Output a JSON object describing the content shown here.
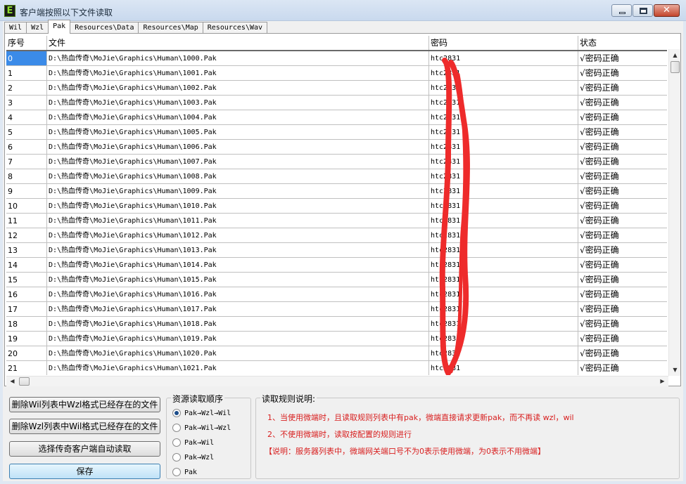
{
  "window": {
    "title": "客户端按照以下文件读取",
    "app_icon_letter": "E"
  },
  "tabs": [
    "Wil",
    "Wzl",
    "Pak",
    "Resources\\Data",
    "Resources\\Map",
    "Resources\\Wav"
  ],
  "active_tab": "Pak",
  "table": {
    "columns": [
      "序号",
      "文件",
      "密码",
      "状态"
    ],
    "rows": [
      {
        "index": "0",
        "file": "D:\\热血传奇\\MoJie\\Graphics\\Human\\1000.Pak",
        "password": "htc2831",
        "status": "√密码正确"
      },
      {
        "index": "1",
        "file": "D:\\热血传奇\\MoJie\\Graphics\\Human\\1001.Pak",
        "password": "htc2831",
        "status": "√密码正确"
      },
      {
        "index": "2",
        "file": "D:\\热血传奇\\MoJie\\Graphics\\Human\\1002.Pak",
        "password": "htc2831",
        "status": "√密码正确"
      },
      {
        "index": "3",
        "file": "D:\\热血传奇\\MoJie\\Graphics\\Human\\1003.Pak",
        "password": "htc2831",
        "status": "√密码正确"
      },
      {
        "index": "4",
        "file": "D:\\热血传奇\\MoJie\\Graphics\\Human\\1004.Pak",
        "password": "htc2831",
        "status": "√密码正确"
      },
      {
        "index": "5",
        "file": "D:\\热血传奇\\MoJie\\Graphics\\Human\\1005.Pak",
        "password": "htc2831",
        "status": "√密码正确"
      },
      {
        "index": "6",
        "file": "D:\\热血传奇\\MoJie\\Graphics\\Human\\1006.Pak",
        "password": "htc2831",
        "status": "√密码正确"
      },
      {
        "index": "7",
        "file": "D:\\热血传奇\\MoJie\\Graphics\\Human\\1007.Pak",
        "password": "htc2831",
        "status": "√密码正确"
      },
      {
        "index": "8",
        "file": "D:\\热血传奇\\MoJie\\Graphics\\Human\\1008.Pak",
        "password": "htc2831",
        "status": "√密码正确"
      },
      {
        "index": "9",
        "file": "D:\\热血传奇\\MoJie\\Graphics\\Human\\1009.Pak",
        "password": "htc2831",
        "status": "√密码正确"
      },
      {
        "index": "10",
        "file": "D:\\热血传奇\\MoJie\\Graphics\\Human\\1010.Pak",
        "password": "htc2831",
        "status": "√密码正确"
      },
      {
        "index": "11",
        "file": "D:\\热血传奇\\MoJie\\Graphics\\Human\\1011.Pak",
        "password": "htc2831",
        "status": "√密码正确"
      },
      {
        "index": "12",
        "file": "D:\\热血传奇\\MoJie\\Graphics\\Human\\1012.Pak",
        "password": "htc2831",
        "status": "√密码正确"
      },
      {
        "index": "13",
        "file": "D:\\热血传奇\\MoJie\\Graphics\\Human\\1013.Pak",
        "password": "htc2831",
        "status": "√密码正确"
      },
      {
        "index": "14",
        "file": "D:\\热血传奇\\MoJie\\Graphics\\Human\\1014.Pak",
        "password": "htc2831",
        "status": "√密码正确"
      },
      {
        "index": "15",
        "file": "D:\\热血传奇\\MoJie\\Graphics\\Human\\1015.Pak",
        "password": "htc2831",
        "status": "√密码正确"
      },
      {
        "index": "16",
        "file": "D:\\热血传奇\\MoJie\\Graphics\\Human\\1016.Pak",
        "password": "htc2831",
        "status": "√密码正确"
      },
      {
        "index": "17",
        "file": "D:\\热血传奇\\MoJie\\Graphics\\Human\\1017.Pak",
        "password": "htc2831",
        "status": "√密码正确"
      },
      {
        "index": "18",
        "file": "D:\\热血传奇\\MoJie\\Graphics\\Human\\1018.Pak",
        "password": "htc2831",
        "status": "√密码正确"
      },
      {
        "index": "19",
        "file": "D:\\热血传奇\\MoJie\\Graphics\\Human\\1019.Pak",
        "password": "htc2831",
        "status": "√密码正确"
      },
      {
        "index": "20",
        "file": "D:\\热血传奇\\MoJie\\Graphics\\Human\\1020.Pak",
        "password": "htc2831",
        "status": "√密码正确"
      },
      {
        "index": "21",
        "file": "D:\\热血传奇\\MoJie\\Graphics\\Human\\1021.Pak",
        "password": "htc2831",
        "status": "√密码正确"
      }
    ]
  },
  "buttons": {
    "delete_wil_dup": "删除Wil列表中Wzl格式已经存在的文件",
    "delete_wzl_dup": "删除Wzl列表中Wil格式已经存在的文件",
    "auto_read": "选择传奇客户端自动读取",
    "save": "保存"
  },
  "order_group": {
    "title": "资源读取顺序",
    "options": [
      "Pak→Wzl→Wil",
      "Pak→Wil→Wzl",
      "Pak→Wil",
      "Pak→Wzl",
      "Pak"
    ],
    "selected": "Pak→Wzl→Wil"
  },
  "rules_group": {
    "title": "读取规则说明:",
    "lines": [
      "1、当使用微端时，且读取规则列表中有pak，微端直接请求更新pak，而不再读 wzl，wil",
      "2、不使用微端时，读取按配置的规则进行",
      "【说明：服务器列表中，微端网关端口号不为0表示使用微端，为0表示不用微端】"
    ]
  },
  "colors": {
    "selection": "#3b8be8",
    "annotation_red": "#ee2b2b",
    "rule_text": "#d81e1e"
  }
}
